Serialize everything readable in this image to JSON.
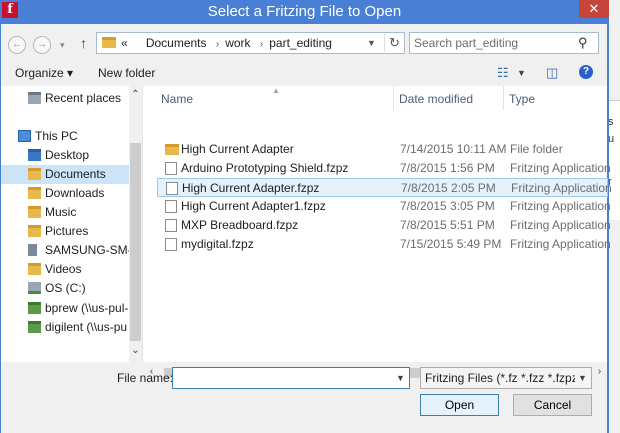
{
  "window": {
    "title": "Select a Fritzing File to Open",
    "app_icon": "f",
    "close": "✕"
  },
  "nav": {
    "back": "←",
    "forward": "→",
    "up": "↑"
  },
  "address": {
    "root_marker": "«",
    "crumbs": [
      "Documents",
      "work",
      "part_editing"
    ]
  },
  "search": {
    "placeholder": "Search part_editing"
  },
  "toolbar": {
    "organize": "Organize ▾",
    "new_folder": "New folder"
  },
  "sidebar": {
    "items": [
      {
        "label": "Recent places",
        "icon": "recent-icon"
      },
      {
        "label": "This PC",
        "icon": "computer-icon"
      },
      {
        "label": "Desktop",
        "icon": "folder-icon"
      },
      {
        "label": "Documents",
        "icon": "folder-icon",
        "selected": true
      },
      {
        "label": "Downloads",
        "icon": "folder-icon"
      },
      {
        "label": "Music",
        "icon": "folder-icon"
      },
      {
        "label": "Pictures",
        "icon": "folder-icon"
      },
      {
        "label": "SAMSUNG-SM-G",
        "icon": "phone-icon"
      },
      {
        "label": "Videos",
        "icon": "folder-icon"
      },
      {
        "label": "OS (C:)",
        "icon": "drive-icon"
      },
      {
        "label": "bprew (\\\\us-pul-",
        "icon": "network-drive-icon"
      },
      {
        "label": "digilent (\\\\us-pu",
        "icon": "network-drive-icon"
      }
    ]
  },
  "columns": {
    "name": "Name",
    "date": "Date modified",
    "type": "Type"
  },
  "files": [
    {
      "name": "High Current Adapter",
      "date": "7/14/2015 10:11 AM",
      "type": "File folder",
      "kind": "folder"
    },
    {
      "name": "Arduino Prototyping Shield.fzpz",
      "date": "7/8/2015 1:56 PM",
      "type": "Fritzing Application",
      "kind": "file"
    },
    {
      "name": "High Current Adapter.fzpz",
      "date": "7/8/2015 2:05 PM",
      "type": "Fritzing Application",
      "kind": "file",
      "selected": true
    },
    {
      "name": "High Current Adapter1.fzpz",
      "date": "7/8/2015 3:05 PM",
      "type": "Fritzing Application",
      "kind": "file"
    },
    {
      "name": "MXP Breadboard.fzpz",
      "date": "7/8/2015 5:51 PM",
      "type": "Fritzing Application",
      "kind": "file"
    },
    {
      "name": "mydigital.fzpz",
      "date": "7/15/2015 5:49 PM",
      "type": "Fritzing Application",
      "kind": "file"
    }
  ],
  "bottom": {
    "file_name_label": "File name:",
    "file_name_value": "",
    "filter": "Fritzing Files (*.fz *.fzz *.fzpz *.fzb",
    "open": "Open",
    "cancel": "Cancel"
  },
  "background_text": {
    "a": "s",
    "b": "u",
    "c": "r"
  },
  "colors": {
    "titlebar": "#4a7fd6",
    "close": "#c7443b",
    "selection": "#cce4f7"
  }
}
